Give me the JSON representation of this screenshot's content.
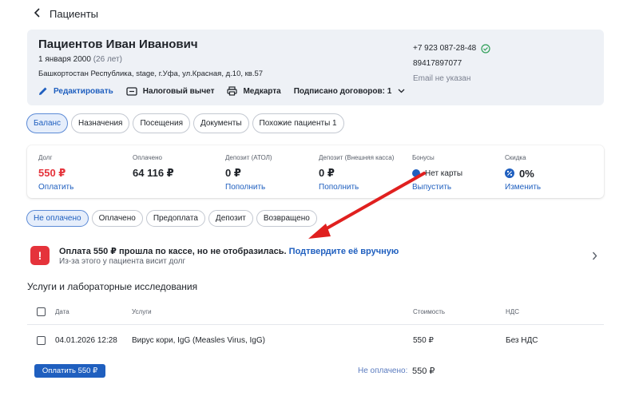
{
  "header": {
    "back_icon": "chevron-left-icon",
    "title": "Пациенты"
  },
  "patient": {
    "name": "Пациентов Иван Иванович",
    "dob": "1 января 2000",
    "age": "(26 лет)",
    "address": "Башкортостан Республика, stage, г.Уфа, ул.Красная, д.10, кв.57",
    "phone": "+7 923 087-28-48",
    "phone2": "89417897077",
    "email": "Email не указан",
    "actions": {
      "edit": "Редактировать",
      "tax": "Налоговый вычет",
      "medcard": "Медкарта",
      "contracts": "Подписано договоров: 1"
    }
  },
  "tabs": [
    "Баланс",
    "Назначения",
    "Посещения",
    "Документы",
    "Похожие пациенты 1"
  ],
  "balance": {
    "debt": {
      "label": "Долг",
      "value": "550 ₽",
      "action": "Оплатить"
    },
    "paid": {
      "label": "Оплачено",
      "value": "64 116 ₽"
    },
    "deposit_atol": {
      "label": "Депозит (АТОЛ)",
      "value": "0 ₽",
      "action": "Пополнить"
    },
    "deposit_ext": {
      "label": "Депозит (Внешняя касса)",
      "value": "0 ₽",
      "action": "Пополнить"
    },
    "bonuses": {
      "label": "Бонусы",
      "value": "Нет карты",
      "action": "Выпустить"
    },
    "discount": {
      "label": "Скидка",
      "value": "0%",
      "action": "Изменить"
    }
  },
  "filters": [
    "Не оплачено",
    "Оплачено",
    "Предоплата",
    "Депозит",
    "Возвращено"
  ],
  "alert": {
    "title": "Оплата 550 ₽ прошла по кассе, но не отобразилась.",
    "link": "Подтвердите её вручную",
    "subtitle": "Из-за этого у пациента висит долг"
  },
  "services": {
    "title": "Услуги и лабораторные исследования",
    "columns": {
      "date": "Дата",
      "service": "Услуги",
      "cost": "Стоимость",
      "vat": "НДС"
    },
    "rows": [
      {
        "date": "04.01.2026 12:28",
        "service": "Вирус кори, IgG (Measles Virus, IgG)",
        "cost": "550 ₽",
        "vat": "Без НДС"
      }
    ]
  },
  "footer": {
    "pay_button": "Оплатить 550 ₽",
    "unpaid_label": "Не оплачено:",
    "unpaid_value": "550 ₽"
  },
  "colors": {
    "accent": "#1f5fbf",
    "danger": "#e5333b",
    "success": "#2e9e57",
    "card_bg": "#eef1f6"
  }
}
